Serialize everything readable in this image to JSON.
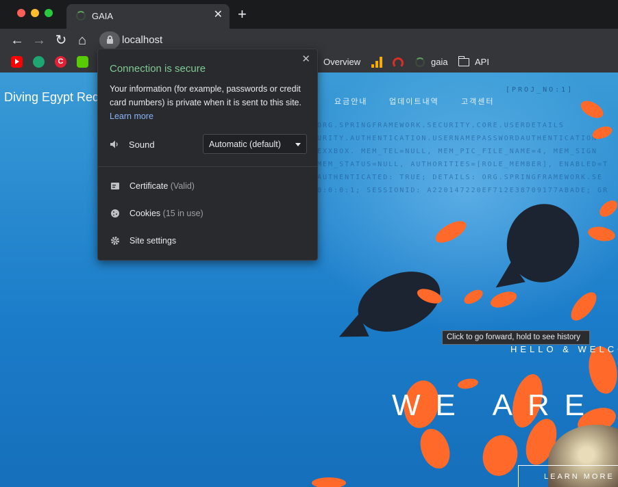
{
  "browser": {
    "tab": {
      "title": "GAIA",
      "close": "✕"
    },
    "new_tab": "+",
    "nav": {
      "back": "←",
      "forward": "→",
      "reload": "↻",
      "home": "⌂"
    },
    "address": "localhost",
    "bookmarks": [
      {
        "icon": "youtube-icon"
      },
      {
        "icon": "green-logo-icon"
      },
      {
        "icon": "c-logo-icon",
        "glyph": "C"
      },
      {
        "icon": "owl-icon"
      },
      {
        "label": "Overview"
      },
      {
        "icon": "bar-chart-icon"
      },
      {
        "icon": "red-arc-icon"
      },
      {
        "label": "gaia",
        "icon": "loading-icon"
      },
      {
        "label": "API",
        "icon": "folder-icon"
      }
    ]
  },
  "site": {
    "title": "Diving Egypt Red",
    "nav": [
      "요금안내",
      "업데이트내역",
      "고객센터"
    ],
    "project_tag": "[PROJ_NO:1]",
    "code_lines": [
      "ORG.SPRINGFRAMEWORK.SECURITY.CORE.USERDETAILS",
      "URITY.AUTHENTICATION.USERNAMEPASSWORDAUTHENTICATION",
      "EXXBOX. MEM_TEL=NULL, MEM_PIC_FILE_NAME=4, MEM_SIGN",
      "MEM_STATUS=NULL, AUTHORITIES=[ROLE_MEMBER], ENABLED=T",
      "AUTHENTICATED: TRUE; DETAILS: ORG.SPRINGFRAMEWORK.SE",
      "0:0:0:1; SESSIONID: A220147220EF712E38709177ABADE; GR"
    ],
    "hello": "HELLO & WELCOME",
    "headline": "WE ARE",
    "cta": "LEARN MORE"
  },
  "tooltip": "Click to go forward, hold to see history",
  "popup": {
    "title": "Connection is secure",
    "description": "Your information (for example, passwords or credit card numbers) is private when it is sent to this site.",
    "learn_more": "Learn more",
    "sound_label": "Sound",
    "sound_value": "Automatic (default)",
    "certificate_label": "Certificate",
    "certificate_status": "(Valid)",
    "cookies_label": "Cookies",
    "cookies_status": "(15 in use)",
    "site_settings_label": "Site settings",
    "close": "✕"
  },
  "colors": {
    "secure_green": "#81c995",
    "link_blue": "#8ab4f8",
    "chrome_dark": "#35363a",
    "ocean_blue": "#1b7cc9",
    "fish_orange": "#ff6a2a"
  }
}
